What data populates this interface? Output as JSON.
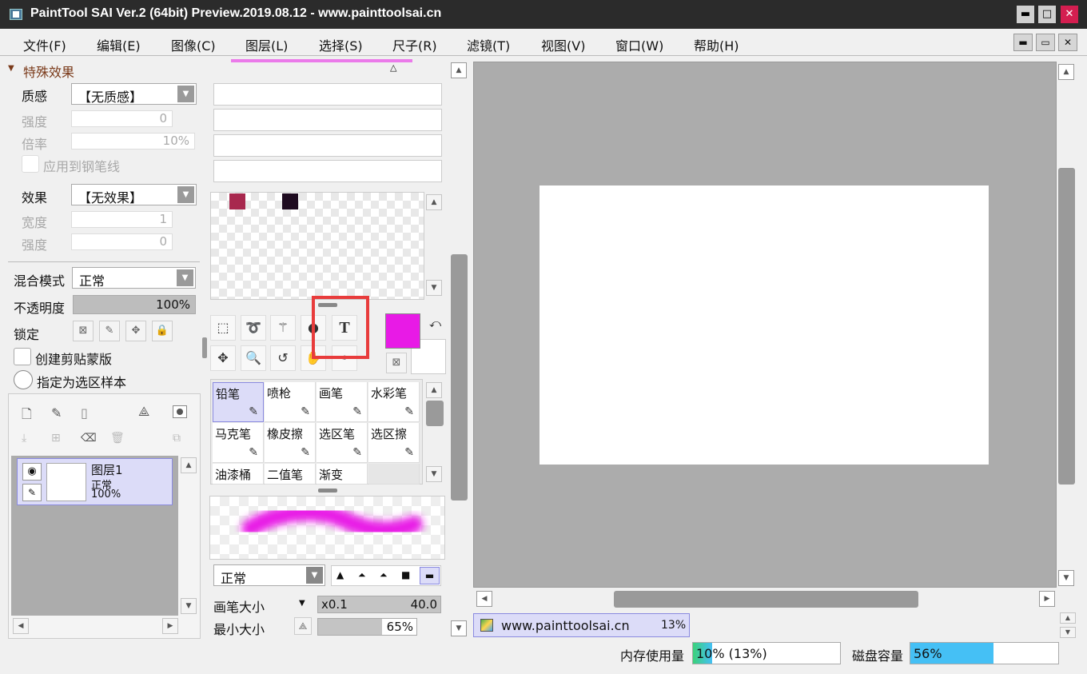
{
  "title": "PaintTool SAI Ver.2 (64bit) Preview.2019.08.12 - www.painttoolsai.cn",
  "window_buttons": [
    "minimize-icon",
    "maximize-icon",
    "close-icon"
  ],
  "menu": [
    "文件(F)",
    "编辑(E)",
    "图像(C)",
    "图层(L)",
    "选择(S)",
    "尺子(R)",
    "滤镜(T)",
    "视图(V)",
    "窗口(W)",
    "帮助(H)"
  ],
  "effects": {
    "section_title": "特殊效果",
    "texture_label": "质感",
    "texture_value": "【无质感】",
    "strength_label": "强度",
    "strength_value": "0",
    "scale_label": "倍率",
    "scale_value": "10%",
    "apply_pen_label": "应用到钢笔线",
    "effect_label": "效果",
    "effect_value": "【无效果】",
    "width_label": "宽度",
    "width_value": "1",
    "strength2_label": "强度",
    "strength2_value": "0"
  },
  "layer_props": {
    "blend_label": "混合模式",
    "blend_value": "正常",
    "opacity_label": "不透明度",
    "opacity_value": "100%",
    "opacity_fraction": 1.0,
    "lock_label": "锁定",
    "clip_label": "创建剪贴蒙版",
    "sample_label": "指定为选区样本"
  },
  "layer": {
    "name": "图层1",
    "mode": "正常",
    "opacity": "100%"
  },
  "swatches": [
    "#a8284e",
    "#1e0b20"
  ],
  "colors": {
    "fg": "#e81ae6",
    "bg": "#ffffff",
    "highlight": "#e83c3c",
    "progress": "#45c0f5",
    "canvas_bg": "#acacac"
  },
  "brushes": [
    {
      "label": "铅笔",
      "icon": "pencil-icon"
    },
    {
      "label": "喷枪",
      "icon": "airbrush-icon"
    },
    {
      "label": "画笔",
      "icon": "brush-icon"
    },
    {
      "label": "水彩笔",
      "icon": "watercolor-icon"
    },
    {
      "label": "马克笔",
      "icon": "marker-icon"
    },
    {
      "label": "橡皮擦",
      "icon": "eraser-icon"
    },
    {
      "label": "选区笔",
      "icon": "select-pen-icon"
    },
    {
      "label": "选区擦",
      "icon": "select-eraser-icon"
    },
    {
      "label": "油漆桶",
      "icon": "bucket-icon"
    },
    {
      "label": "二值笔",
      "icon": "binary-pen-icon"
    },
    {
      "label": "渐变",
      "icon": "gradient-icon"
    }
  ],
  "brush_settings": {
    "mode_value": "正常",
    "size_label": "画笔大小",
    "size_mult": "x0.1",
    "size_value": "40.0",
    "min_label": "最小大小",
    "min_value": "65%",
    "min_fraction": 0.65
  },
  "tab": {
    "label": "www.painttoolsai.cn",
    "zoom": "13%"
  },
  "status": {
    "mem_label": "内存使用量",
    "mem_value": "10% (13%)",
    "mem_fraction": 0.1,
    "disk_label": "磁盘容量",
    "disk_value": "56%",
    "disk_fraction": 0.56
  }
}
